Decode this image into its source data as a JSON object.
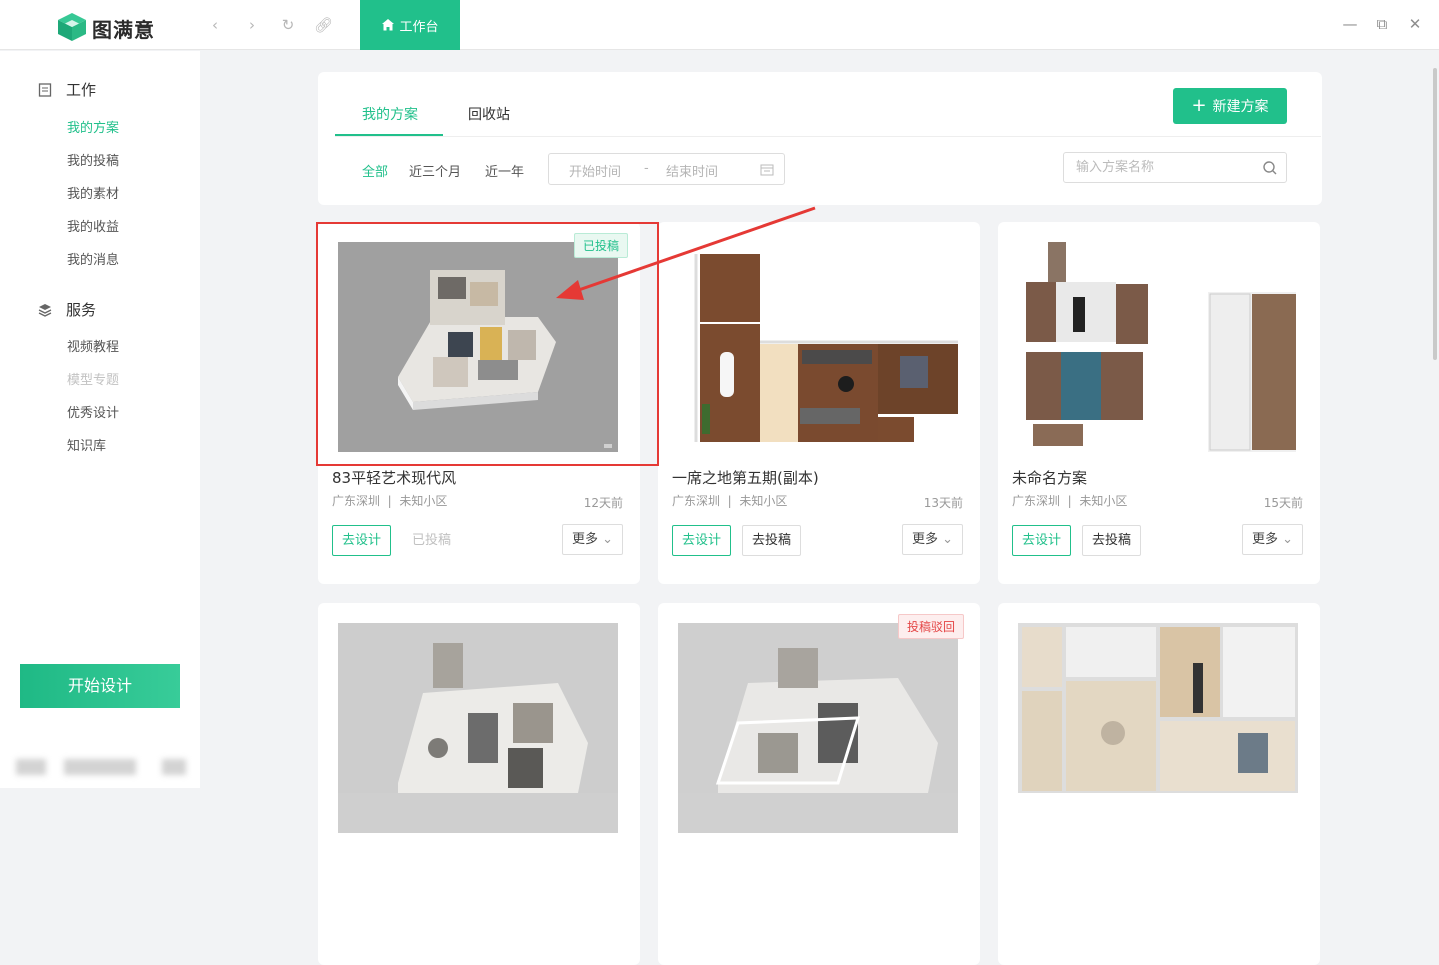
{
  "app": {
    "name": "图满意"
  },
  "titlebar": {
    "tab_label": "工作台"
  },
  "sidebar": {
    "work_title": "工作",
    "work_items": [
      "我的方案",
      "我的投稿",
      "我的素材",
      "我的收益",
      "我的消息"
    ],
    "service_title": "服务",
    "service_items": [
      "视频教程",
      "模型专题",
      "优秀设计",
      "知识库"
    ],
    "start_button": "开始设计"
  },
  "main": {
    "tabs": [
      "我的方案",
      "回收站"
    ],
    "new_button": "新建方案",
    "filters": [
      "全部",
      "近三个月",
      "近一年"
    ],
    "date_start_placeholder": "开始时间",
    "date_sep": "-",
    "date_end_placeholder": "结束时间",
    "search_placeholder": "输入方案名称",
    "cards": [
      {
        "title": "83平轻艺术现代风",
        "location": "广东深圳",
        "community": "未知小区",
        "time": "12天前",
        "design": "去设计",
        "submit": "已投稿",
        "more": "更多",
        "badge": "已投稿"
      },
      {
        "title": "一席之地第五期(副本)",
        "location": "广东深圳",
        "community": "未知小区",
        "time": "13天前",
        "design": "去设计",
        "submit": "去投稿",
        "more": "更多"
      },
      {
        "title": "未命名方案",
        "location": "广东深圳",
        "community": "未知小区",
        "time": "15天前",
        "design": "去设计",
        "submit": "去投稿",
        "more": "更多"
      },
      {
        "badge": ""
      },
      {
        "badge": "投稿驳回"
      },
      {
        "badge": ""
      }
    ],
    "location_sep": "|"
  },
  "colors": {
    "accent": "#21c08b",
    "highlight": "#e53935",
    "reject": "#e44646"
  }
}
